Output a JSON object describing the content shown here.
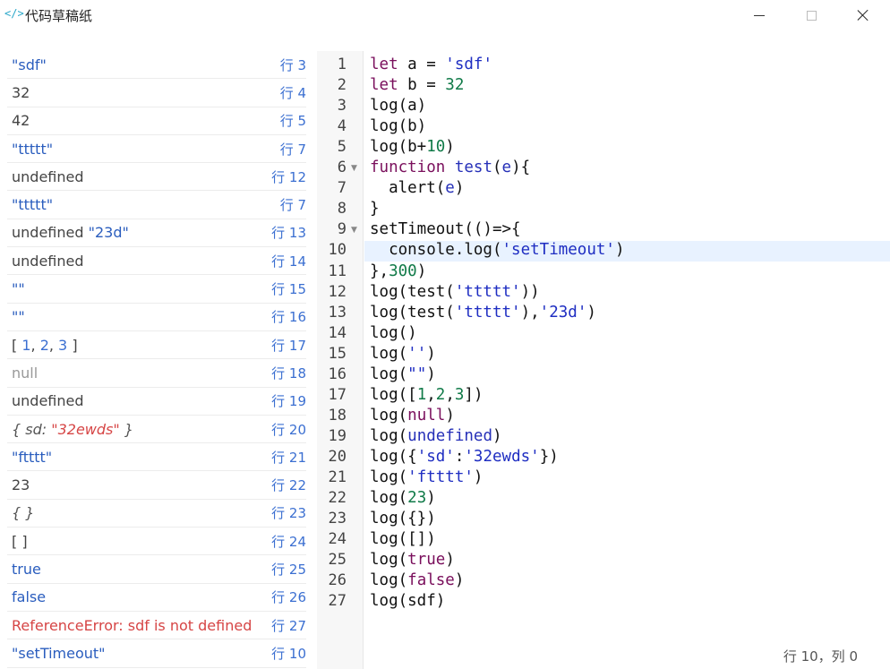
{
  "app": {
    "title": "代码草稿纸",
    "icon": "</>"
  },
  "output": [
    {
      "parts": [
        {
          "t": "\"sdf\"",
          "c": "c-string"
        }
      ],
      "line": "行 3"
    },
    {
      "parts": [
        {
          "t": "32",
          "c": "c-plain"
        }
      ],
      "line": "行 4"
    },
    {
      "parts": [
        {
          "t": "42",
          "c": "c-plain"
        }
      ],
      "line": "行 5"
    },
    {
      "parts": [
        {
          "t": "\"ttttt\"",
          "c": "c-string"
        }
      ],
      "line": "行 7"
    },
    {
      "parts": [
        {
          "t": "undefined",
          "c": "c-plain"
        }
      ],
      "line": "行 12"
    },
    {
      "parts": [
        {
          "t": "\"ttttt\"",
          "c": "c-string"
        }
      ],
      "line": "行 7"
    },
    {
      "parts": [
        {
          "t": "undefined ",
          "c": "c-plain"
        },
        {
          "t": "\"23d\"",
          "c": "c-string"
        }
      ],
      "line": "行 13"
    },
    {
      "parts": [
        {
          "t": "undefined",
          "c": "c-plain"
        }
      ],
      "line": "行 14"
    },
    {
      "parts": [
        {
          "t": "\"\"",
          "c": "c-string"
        }
      ],
      "line": "行 15"
    },
    {
      "parts": [
        {
          "t": "\"\"",
          "c": "c-string"
        }
      ],
      "line": "行 16"
    },
    {
      "parts": [
        {
          "t": "[ ",
          "c": "c-plain"
        },
        {
          "t": "1",
          "c": "c-num"
        },
        {
          "t": ", ",
          "c": "c-plain"
        },
        {
          "t": "2",
          "c": "c-num"
        },
        {
          "t": ", ",
          "c": "c-plain"
        },
        {
          "t": "3",
          "c": "c-num"
        },
        {
          "t": " ]",
          "c": "c-plain"
        }
      ],
      "line": "行 17"
    },
    {
      "parts": [
        {
          "t": "null",
          "c": "c-null"
        }
      ],
      "line": "行 18"
    },
    {
      "parts": [
        {
          "t": "undefined",
          "c": "c-plain"
        }
      ],
      "line": "行 19"
    },
    {
      "parts": [
        {
          "t": "{ sd: ",
          "c": "c-obj"
        },
        {
          "t": "\"32ewds\"",
          "c": "c-objval"
        },
        {
          "t": " }",
          "c": "c-obj"
        }
      ],
      "line": "行 20"
    },
    {
      "parts": [
        {
          "t": "\"ftttt\"",
          "c": "c-string"
        }
      ],
      "line": "行 21"
    },
    {
      "parts": [
        {
          "t": "23",
          "c": "c-plain"
        }
      ],
      "line": "行 22"
    },
    {
      "parts": [
        {
          "t": "{ }",
          "c": "c-obj"
        }
      ],
      "line": "行 23"
    },
    {
      "parts": [
        {
          "t": "[ ]",
          "c": "c-plain"
        }
      ],
      "line": "行 24"
    },
    {
      "parts": [
        {
          "t": "true",
          "c": "c-bool"
        }
      ],
      "line": "行 25"
    },
    {
      "parts": [
        {
          "t": "false",
          "c": "c-bool"
        }
      ],
      "line": "行 26"
    },
    {
      "parts": [
        {
          "t": "ReferenceError: sdf is not defined",
          "c": "c-error"
        }
      ],
      "line": "行 27"
    },
    {
      "parts": [
        {
          "t": "\"setTimeout\"",
          "c": "c-string"
        }
      ],
      "line": "行 10"
    }
  ],
  "editor": {
    "active_line": 10,
    "fold_lines": [
      6,
      9
    ],
    "lines": [
      [
        {
          "t": "let",
          "c": "kw"
        },
        {
          "t": " a = "
        },
        {
          "t": "'sdf'",
          "c": "str"
        }
      ],
      [
        {
          "t": "let",
          "c": "kw"
        },
        {
          "t": " b = "
        },
        {
          "t": "32",
          "c": "num"
        }
      ],
      [
        {
          "t": "log(a)"
        }
      ],
      [
        {
          "t": "log(b)"
        }
      ],
      [
        {
          "t": "log(b+"
        },
        {
          "t": "10",
          "c": "num"
        },
        {
          "t": ")"
        }
      ],
      [
        {
          "t": "function",
          "c": "kw"
        },
        {
          "t": " "
        },
        {
          "t": "test",
          "c": "fn"
        },
        {
          "t": "("
        },
        {
          "t": "e",
          "c": "var"
        },
        {
          "t": "){"
        }
      ],
      [
        {
          "t": "  alert("
        },
        {
          "t": "e",
          "c": "var"
        },
        {
          "t": ")"
        }
      ],
      [
        {
          "t": "}"
        }
      ],
      [
        {
          "t": "setTimeout(()=>{"
        }
      ],
      [
        {
          "t": "  console.log("
        },
        {
          "t": "'setTimeout'",
          "c": "str"
        },
        {
          "t": ")"
        }
      ],
      [
        {
          "t": "},"
        },
        {
          "t": "300",
          "c": "num"
        },
        {
          "t": ")"
        }
      ],
      [
        {
          "t": "log(test("
        },
        {
          "t": "'ttttt'",
          "c": "str"
        },
        {
          "t": "))"
        }
      ],
      [
        {
          "t": "log(test("
        },
        {
          "t": "'ttttt'",
          "c": "str"
        },
        {
          "t": "),"
        },
        {
          "t": "'23d'",
          "c": "str"
        },
        {
          "t": ")"
        }
      ],
      [
        {
          "t": "log()"
        }
      ],
      [
        {
          "t": "log("
        },
        {
          "t": "''",
          "c": "str"
        },
        {
          "t": ")"
        }
      ],
      [
        {
          "t": "log("
        },
        {
          "t": "\"\"",
          "c": "str"
        },
        {
          "t": ")"
        }
      ],
      [
        {
          "t": "log(["
        },
        {
          "t": "1",
          "c": "num"
        },
        {
          "t": ","
        },
        {
          "t": "2",
          "c": "num"
        },
        {
          "t": ","
        },
        {
          "t": "3",
          "c": "num"
        },
        {
          "t": "])"
        }
      ],
      [
        {
          "t": "log("
        },
        {
          "t": "null",
          "c": "kw"
        },
        {
          "t": ")"
        }
      ],
      [
        {
          "t": "log("
        },
        {
          "t": "undefined",
          "c": "var"
        },
        {
          "t": ")"
        }
      ],
      [
        {
          "t": "log({"
        },
        {
          "t": "'sd'",
          "c": "str"
        },
        {
          "t": ":"
        },
        {
          "t": "'32ewds'",
          "c": "str"
        },
        {
          "t": "})"
        }
      ],
      [
        {
          "t": "log("
        },
        {
          "t": "'ftttt'",
          "c": "str"
        },
        {
          "t": ")"
        }
      ],
      [
        {
          "t": "log("
        },
        {
          "t": "23",
          "c": "num"
        },
        {
          "t": ")"
        }
      ],
      [
        {
          "t": "log({})"
        }
      ],
      [
        {
          "t": "log([])"
        }
      ],
      [
        {
          "t": "log("
        },
        {
          "t": "true",
          "c": "kw"
        },
        {
          "t": ")"
        }
      ],
      [
        {
          "t": "log("
        },
        {
          "t": "false",
          "c": "kw"
        },
        {
          "t": ")"
        }
      ],
      [
        {
          "t": "log(sdf)"
        }
      ]
    ]
  },
  "status": {
    "cursor": "行 10，列 0"
  },
  "colors": {
    "accent": "#3b6fd1",
    "keyword": "#7a0f5c",
    "string": "#1f2ec2",
    "number": "#107a48",
    "error": "#d64545",
    "active_line": "#e8f2ff"
  }
}
